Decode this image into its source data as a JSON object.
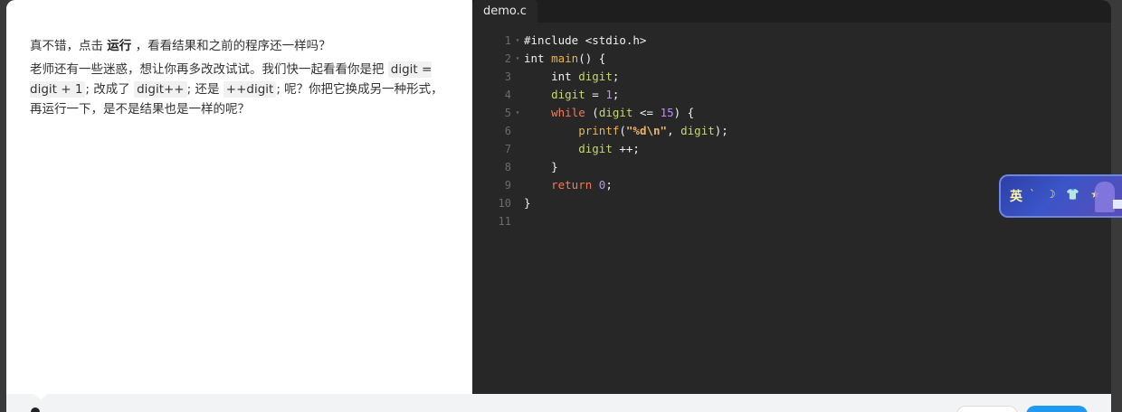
{
  "lesson": {
    "para1_prefix": "真不错，点击 ",
    "para1_bold": "运行",
    "para1_suffix": " ，看看结果和之前的程序还一样吗？",
    "para2_a": "老师还有一些迷惑，想让你再多改改试试。我们快一起看看你是把 ",
    "para2_code1": "digit = digit + 1",
    "para2_b": "; 改成了 ",
    "para2_code2": "digit++",
    "para2_c": "; 还是 ",
    "para2_code3": "++digit",
    "para2_d": "; 呢？你把它换成另一种形式，再运行一下，是不是结果也是一样的呢？"
  },
  "editor": {
    "tab_label": "demo.c",
    "lines": [
      {
        "n": "1",
        "fold": "▾"
      },
      {
        "n": "2",
        "fold": "▾"
      },
      {
        "n": "3",
        "fold": ""
      },
      {
        "n": "4",
        "fold": ""
      },
      {
        "n": "5",
        "fold": "▾"
      },
      {
        "n": "6",
        "fold": ""
      },
      {
        "n": "7",
        "fold": ""
      },
      {
        "n": "8",
        "fold": ""
      },
      {
        "n": "9",
        "fold": ""
      },
      {
        "n": "10",
        "fold": ""
      },
      {
        "n": "11",
        "fold": ""
      }
    ],
    "code": {
      "l1": "#include <stdio.h>",
      "l2_type": "int",
      "l2_fn": "main",
      "l2_rest": "() {",
      "l3_type": "int",
      "l3_var": "digit",
      "l3_rest": ";",
      "l4_var": "digit",
      "l4_op": " = ",
      "l4_num": "1",
      "l4_rest": ";",
      "l5_kw": "while",
      "l5_a": " (",
      "l5_var": "digit",
      "l5_op": " <= ",
      "l5_num": "15",
      "l5_rest": ") {",
      "l6_fn": "printf",
      "l6_a": "(",
      "l6_str": "\"%d\\n\"",
      "l6_b": ", ",
      "l6_var": "digit",
      "l6_rest": ");",
      "l7_var": "digit",
      "l7_rest": " ++;",
      "l8": "}",
      "l9_kw": "return",
      "l9_sp": " ",
      "l9_num": "0",
      "l9_rest": ";",
      "l10": "}"
    }
  },
  "ime": {
    "label": "英",
    "glyphs": "ˋ ☽ 👕 ★"
  },
  "colors": {
    "editor_bg": "#272727",
    "keyword": "#f07a5c",
    "function": "#e6b455",
    "variable": "#c7d66e",
    "number": "#c08bff",
    "primary_button": "#1e9bf0"
  }
}
